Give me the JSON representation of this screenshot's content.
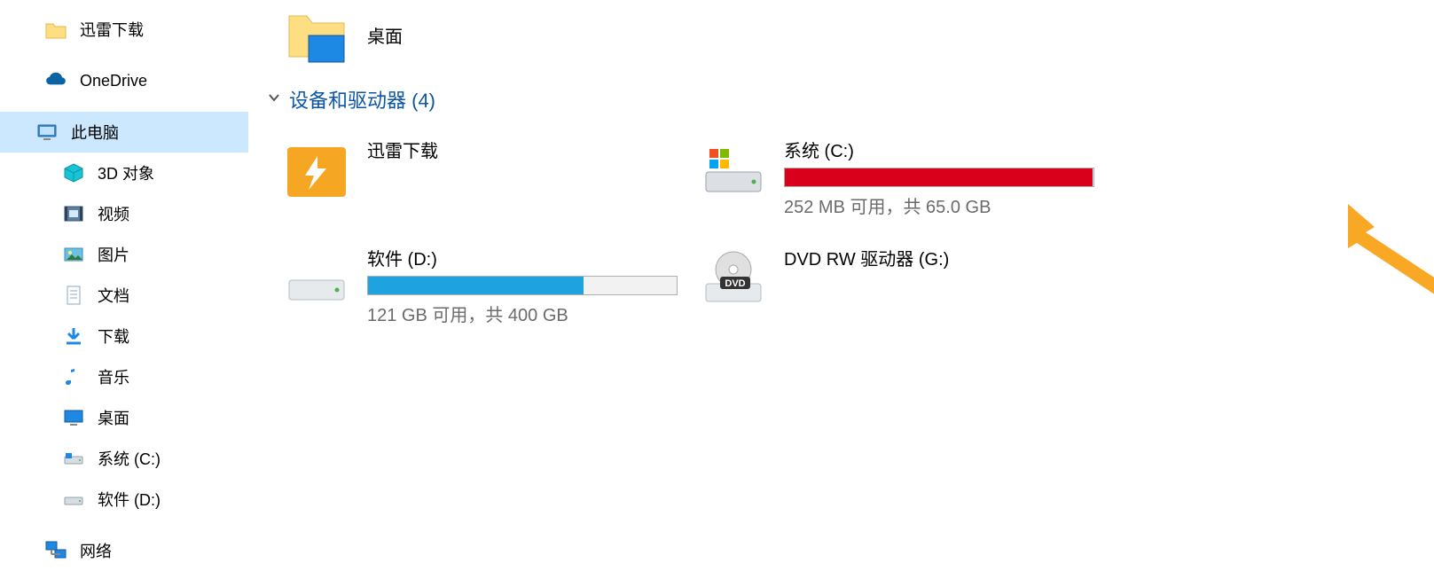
{
  "sidebar": {
    "items": [
      {
        "label": "迅雷下载",
        "icon": "folder"
      },
      {
        "label": "OneDrive",
        "icon": "onedrive"
      },
      {
        "label": "此电脑",
        "icon": "thispc",
        "selected": true
      },
      {
        "label": "3D 对象",
        "icon": "3d",
        "depth": 1
      },
      {
        "label": "视频",
        "icon": "video",
        "depth": 1
      },
      {
        "label": "图片",
        "icon": "pictures",
        "depth": 1
      },
      {
        "label": "文档",
        "icon": "documents",
        "depth": 1
      },
      {
        "label": "下载",
        "icon": "downloads",
        "depth": 1
      },
      {
        "label": "音乐",
        "icon": "music",
        "depth": 1
      },
      {
        "label": "桌面",
        "icon": "desktop",
        "depth": 1
      },
      {
        "label": "系统 (C:)",
        "icon": "drive",
        "depth": 1
      },
      {
        "label": "软件 (D:)",
        "icon": "drive",
        "depth": 1
      },
      {
        "label": "网络",
        "icon": "network"
      }
    ]
  },
  "content": {
    "folder_item": {
      "label": "桌面"
    },
    "section_header": "设备和驱动器 (4)",
    "grid": [
      {
        "type": "folder-thunder",
        "title": "迅雷下载"
      },
      {
        "type": "drive",
        "title": "系统 (C:)",
        "fill_pct": 99.6,
        "fill_color": "#d9001b",
        "subtext": "252 MB 可用，共 65.0 GB",
        "os": true
      },
      {
        "type": "drive",
        "title": "软件 (D:)",
        "fill_pct": 69.8,
        "fill_color": "#1fa3e0",
        "subtext": "121 GB 可用，共 400 GB"
      },
      {
        "type": "dvd",
        "title": "DVD RW 驱动器 (G:)"
      }
    ]
  },
  "colors": {
    "arrow": "#f9a825"
  }
}
